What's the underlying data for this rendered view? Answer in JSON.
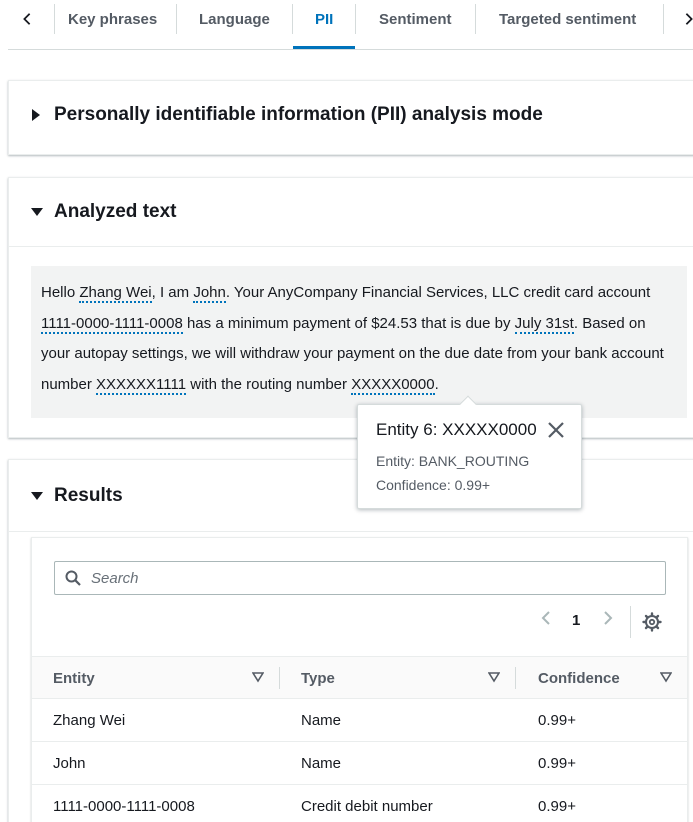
{
  "tabs": {
    "items": [
      {
        "label": "Key phrases"
      },
      {
        "label": "Language"
      },
      {
        "label": "PII"
      },
      {
        "label": "Sentiment"
      },
      {
        "label": "Targeted sentiment"
      }
    ],
    "active": "PII"
  },
  "pii_mode_panel": {
    "title": "Personally identifiable information (PII) analysis mode"
  },
  "analyzed_panel": {
    "title": "Analyzed text",
    "text": {
      "s1": "Hello ",
      "e1": "Zhang Wei",
      "s2": ", I am ",
      "e2": "John",
      "s3": ". Your AnyCompany Financial Services, LLC credit card account ",
      "e3": "1111-0000-1111-0008",
      "s4": " has a minimum payment of $24.53 that is due by ",
      "e4": "July 31st",
      "s5": ". Based on your autopay settings, we will withdraw your payment on the due date from your bank account number ",
      "e5": "XXXXXX1111",
      "s6": " with the routing number ",
      "e6": "XXXXX0000",
      "s7": "."
    }
  },
  "popover": {
    "title": "Entity 6: XXXXX0000",
    "entity": "Entity: BANK_ROUTING",
    "confidence": "Confidence: 0.99+"
  },
  "results_panel": {
    "title": "Results",
    "search": {
      "placeholder": "Search",
      "value": ""
    },
    "pagination": {
      "current_page": "1"
    },
    "columns": [
      "Entity",
      "Type",
      "Confidence"
    ],
    "rows": [
      {
        "entity": "Zhang Wei",
        "type": "Name",
        "confidence": "0.99+"
      },
      {
        "entity": "John",
        "type": "Name",
        "confidence": "0.99+"
      },
      {
        "entity": "1111-0000-1111-0008",
        "type": "Credit debit number",
        "confidence": "0.99+"
      }
    ]
  },
  "colors": {
    "accent": "#0073bb",
    "text": "#16191f",
    "muted": "#545b64",
    "text_background": "#f2f3f3"
  }
}
